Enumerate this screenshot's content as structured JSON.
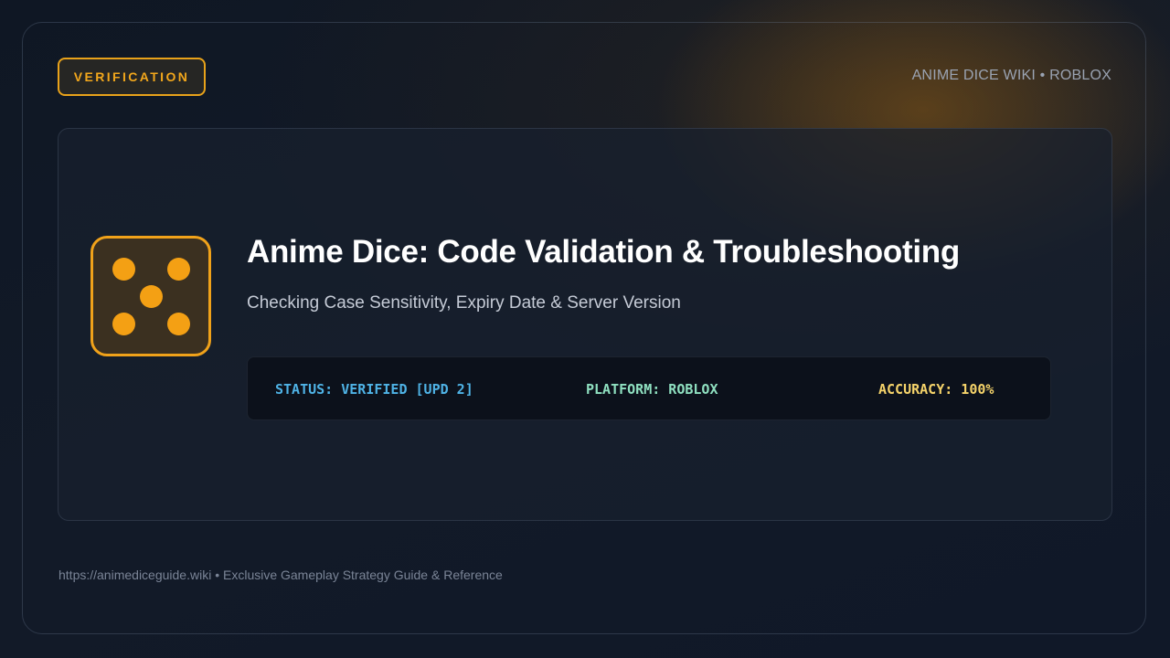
{
  "badge": {
    "label": "VERIFICATION"
  },
  "brand": {
    "text": "ANIME DICE WIKI • ROBLOX"
  },
  "hero": {
    "icon": "dice-five-icon",
    "title": "Anime Dice: Code Validation & Troubleshooting",
    "subtitle": "Checking Case Sensitivity, Expiry Date & Server Version"
  },
  "status_bar": {
    "status": "STATUS: VERIFIED [UPD 2]",
    "platform": "PLATFORM: ROBLOX",
    "accuracy": "ACCURACY: 100%"
  },
  "footer": {
    "text": "https://animediceguide.wiki • Exclusive Gameplay Strategy Guide & Reference"
  },
  "colors": {
    "accent": "#f0a21a",
    "status": "#4fb3e6",
    "platform": "#8fe0c0",
    "accuracy": "#f5d36a"
  }
}
